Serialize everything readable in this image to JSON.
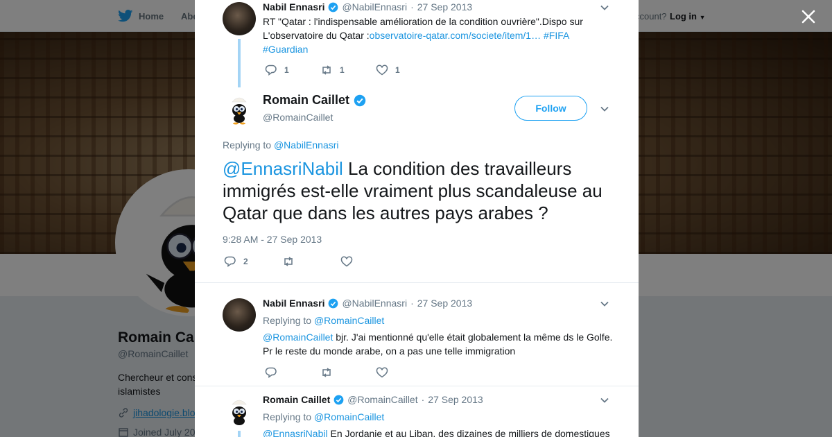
{
  "nav": {
    "home_label": "Home",
    "about_label": "Abo",
    "account_prompt": "ccount?",
    "login_label": "Log in"
  },
  "profile": {
    "name": "Romain Ca",
    "handle": "@RomainCaillet",
    "bio": "Chercheur et cons islamistes",
    "link": "jihadologie.blo",
    "joined": "Joined July 20"
  },
  "thread": {
    "parent": {
      "name": "Nabil Ennasri",
      "handle": "@NabilEnnasri",
      "date": "27 Sep 2013",
      "text_before": "RT \"Qatar : l'indispensable amélioration de la condition ouvrière\".Dispo sur L'observatoire du Qatar :",
      "link_url": "observatoire-qatar.com/societe/item/1…",
      "hashtag1": "#FIFA",
      "hashtag2": "#Guardian",
      "replies": "1",
      "retweets": "1",
      "likes": "1"
    },
    "main": {
      "name": "Romain Caillet",
      "handle": "@RomainCaillet",
      "follow_label": "Follow",
      "replying_prefix": "Replying to",
      "replying_to": "@NabilEnnasri",
      "mention": "@EnnasriNabil",
      "text": " La condition des travailleurs immigrés est-elle vraiment plus scandaleuse au Qatar que dans les autres pays arabes ?",
      "timestamp": "9:28 AM - 27 Sep 2013",
      "replies": "2"
    },
    "reply1": {
      "name": "Nabil Ennasri",
      "handle": "@NabilEnnasri",
      "date": "27 Sep 2013",
      "replying_prefix": "Replying to",
      "replying_to": "@RomainCaillet",
      "mention": "@RomainCaillet",
      "text": " bjr. J'ai mentionné qu'elle était globalement la même ds le Golfe. Pr le reste du monde arabe, on a pas une telle immigration"
    },
    "reply2": {
      "name": "Romain Caillet",
      "handle": "@RomainCaillet",
      "date": "27 Sep 2013",
      "replying_prefix": "Replying to",
      "replying_to": "@RomainCaillet",
      "mention": "@EnnasriNabil",
      "text": " En Jordanie et au Liban, des dizaines de milliers de domestiques"
    }
  },
  "colors": {
    "accent": "#1da1f2",
    "link": "#1b95e0",
    "muted": "#657786",
    "verified": "#1da1f2",
    "thread_line": "#a3d4f5"
  },
  "icons": [
    "twitter-bird-icon",
    "close-icon",
    "chevron-down-icon",
    "verified-badge-icon",
    "reply-icon",
    "retweet-icon",
    "like-icon",
    "link-icon",
    "calendar-icon"
  ]
}
